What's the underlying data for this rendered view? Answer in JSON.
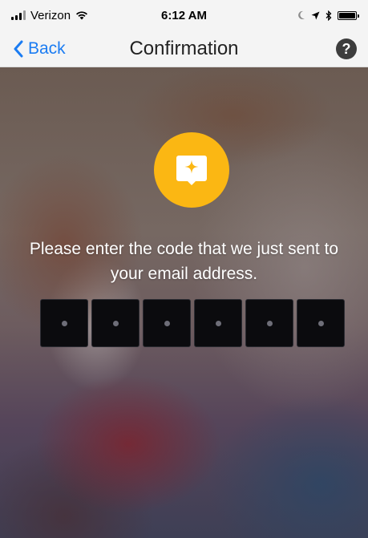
{
  "status_bar": {
    "carrier": "Verizon",
    "time": "6:12 AM"
  },
  "nav": {
    "back_label": "Back",
    "title": "Confirmation",
    "help_label": "?"
  },
  "content": {
    "icon": "chat-sparkle-icon",
    "accent_color": "#fbb713",
    "prompt": "Please enter the code that we just sent to your email address.",
    "code_length": 6,
    "code_values": [
      "",
      "",
      "",
      "",
      "",
      ""
    ]
  },
  "colors": {
    "link_blue": "#1b7cf2",
    "code_box": "#0b0b0e"
  }
}
